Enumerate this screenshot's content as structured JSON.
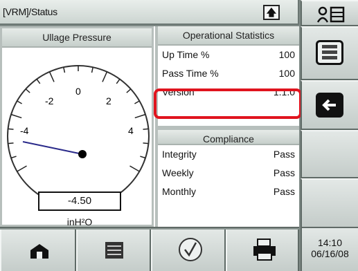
{
  "titlebar": {
    "title": "[VRM]/Status",
    "up_icon": "up-arrow-icon"
  },
  "gauge": {
    "header": "Ullage Pressure",
    "ticks": [
      "-4",
      "-2",
      "0",
      "2",
      "4"
    ],
    "value": "-4.50",
    "value_number": -4.5,
    "unit": "inH²O"
  },
  "stats": {
    "header": "Operational Statistics",
    "rows": [
      {
        "label": "Up Time %",
        "value": "100"
      },
      {
        "label": "Pass Time %",
        "value": "100"
      },
      {
        "label": "Version",
        "value": "1.1.0"
      }
    ]
  },
  "compliance": {
    "header": "Compliance",
    "rows": [
      {
        "label": "Integrity",
        "value": "Pass"
      },
      {
        "label": "Weekly",
        "value": "Pass"
      },
      {
        "label": "Monthly",
        "value": "Pass"
      }
    ]
  },
  "clock": {
    "time": "14:10",
    "date": "06/16/08"
  },
  "colors": {
    "highlight": "#e0141e",
    "needle": "#2a2a8a"
  }
}
